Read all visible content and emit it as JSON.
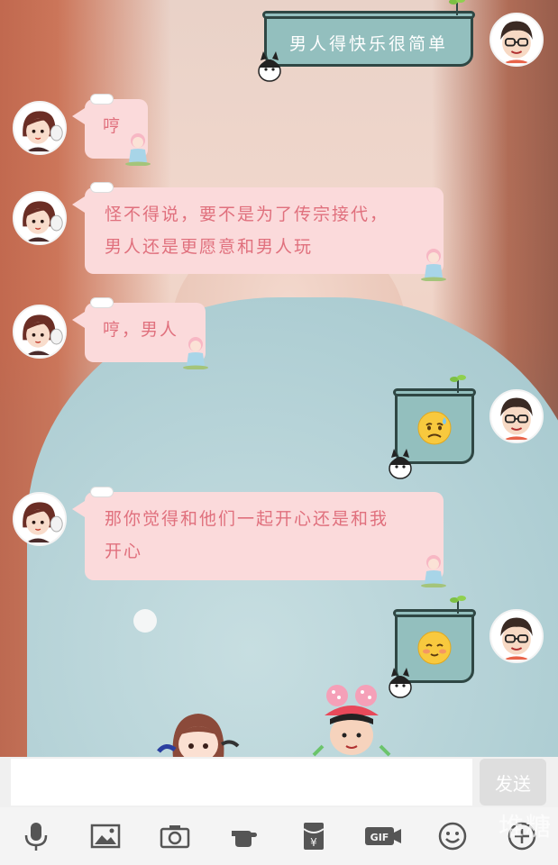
{
  "messages": [
    {
      "side": "right",
      "type": "text",
      "text": "男人得快乐很简单"
    },
    {
      "side": "left",
      "type": "text",
      "lines": [
        "哼"
      ]
    },
    {
      "side": "left",
      "type": "text",
      "lines": [
        "怪不得说，要不是为了传宗接代，",
        "男人还是更愿意和男人玩"
      ]
    },
    {
      "side": "left",
      "type": "text",
      "lines": [
        "哼，男人"
      ]
    },
    {
      "side": "right",
      "type": "emoji",
      "emoji": "sad-sweat-face"
    },
    {
      "side": "left",
      "type": "text",
      "lines": [
        "那你觉得和他们一起开心还是和我",
        "开心"
      ]
    },
    {
      "side": "right",
      "type": "emoji",
      "emoji": "blushing-smile-face"
    }
  ],
  "composer": {
    "input_value": "",
    "send_label": "发送"
  },
  "toolbar": {
    "items": [
      "microphone-icon",
      "image-icon",
      "camera-icon",
      "hand-icon",
      "red-envelope-icon",
      "gif-icon",
      "emoji-icon",
      "plus-icon"
    ],
    "gif_label": "GIF",
    "envelope_label": "¥"
  },
  "watermark": "堆糖",
  "colors": {
    "pink_bubble": "#fbdadb",
    "pink_text": "#e0707d",
    "teal_bubble": "#93bfbe",
    "send_button": "#dedede"
  }
}
